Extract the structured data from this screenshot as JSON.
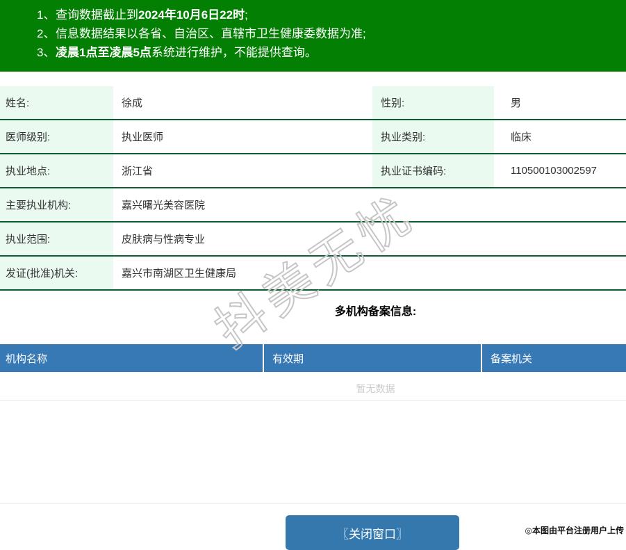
{
  "notices": [
    {
      "num": "1、",
      "pre": "查询数据截止到",
      "bold": "2024年10月6日22时",
      "post": ";"
    },
    {
      "num": "2、",
      "pre": "信息数据结果以各省、自治区、直辖市卫生健康委数据为准;",
      "bold": "",
      "post": ""
    },
    {
      "num": "3、",
      "pre": "",
      "bold": "凌晨1点至凌晨5点",
      "post": "系统进行维护，不能提供查询。"
    }
  ],
  "info_rows": [
    {
      "label": "姓名:",
      "value": "徐成",
      "label2": "性别:",
      "value2": "男"
    },
    {
      "label": "医师级别:",
      "value": "执业医师",
      "label2": "执业类别:",
      "value2": "临床"
    },
    {
      "label": "执业地点:",
      "value": "浙江省",
      "label2": "执业证书编码:",
      "value2": "110500103002597"
    },
    {
      "label": "主要执业机构:",
      "value": "嘉兴曙光美容医院"
    },
    {
      "label": "执业范围:",
      "value": "皮肤病与性病专业"
    },
    {
      "label": "发证(批准)机关:",
      "value": "嘉兴市南湖区卫生健康局"
    }
  ],
  "filing_table": {
    "title": "多机构备案信息:",
    "headers": [
      "机构名称",
      "有效期",
      "备案机关"
    ],
    "empty_text": "暂无数据"
  },
  "footer": {
    "close_button": "〖关闭窗口〗",
    "credit": "◎本图由平台注册用户上传"
  },
  "watermark": {
    "text": "抖美无忧"
  },
  "colors": {
    "banner_green": "#038003",
    "row_border_green": "#0b5e33",
    "label_bg_green": "#eafaf1",
    "table_header_blue": "#3779b5",
    "button_blue": "#3578ad"
  }
}
